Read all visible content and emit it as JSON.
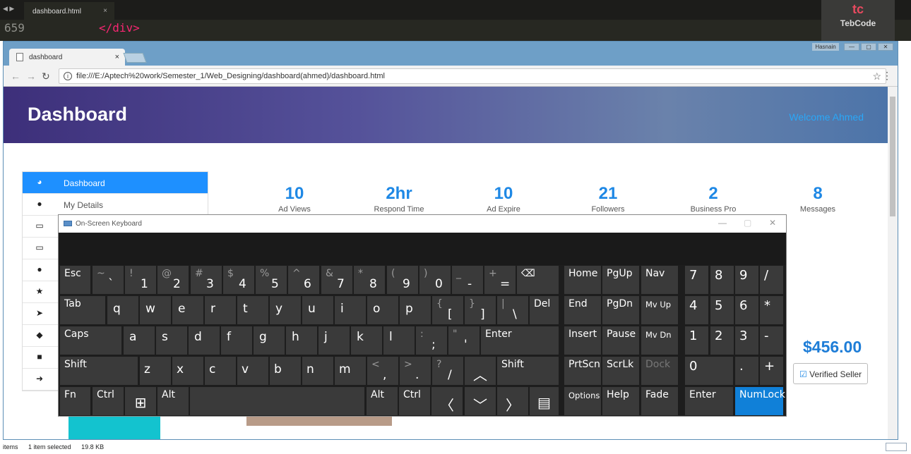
{
  "editor": {
    "tab_label": "dashboard.html",
    "tab_close": "×",
    "nav_arrows": "◀ ▶",
    "menu_glyph": "▼",
    "line_number": "659",
    "code_line": "</div>"
  },
  "logo": {
    "mark": "tc",
    "name": "TebCode"
  },
  "browser": {
    "tab_title": "dashboard",
    "tab_close": "×",
    "user_badge": "Hasnain",
    "window_buttons": [
      "—",
      "▢",
      "✕"
    ],
    "url": "file:///E:/Aptech%20work/Semester_1/Web_Designing/dashboard(ahmed)/dashboard.html",
    "nav": {
      "back": "←",
      "forward": "→",
      "reload": "↻",
      "info": "i",
      "star": "☆",
      "menu": "⋮"
    }
  },
  "page": {
    "title": "Dashboard",
    "welcome": "Welcome Ahmed",
    "sidebar": [
      {
        "label": "Dashboard",
        "icon": "dashboard-icon",
        "glyph": "◕",
        "active": true
      },
      {
        "label": "My Details",
        "icon": "user-icon",
        "glyph": "●",
        "active": false
      },
      {
        "label": "",
        "icon": "laptop-icon",
        "glyph": "▭",
        "active": false
      },
      {
        "label": "",
        "icon": "laptop-icon",
        "glyph": "▭",
        "active": false
      },
      {
        "label": "",
        "icon": "comment-icon",
        "glyph": "●",
        "active": false
      },
      {
        "label": "",
        "icon": "star-icon",
        "glyph": "★",
        "active": false
      },
      {
        "label": "",
        "icon": "paper-plane-icon",
        "glyph": "➤",
        "active": false
      },
      {
        "label": "",
        "icon": "tag-icon",
        "glyph": "◆",
        "active": false
      },
      {
        "label": "",
        "icon": "lock-icon",
        "glyph": "■",
        "active": false
      },
      {
        "label": "",
        "icon": "sign-out-icon",
        "glyph": "➜",
        "active": false
      }
    ],
    "stats": [
      {
        "value": "10",
        "label": "Ad Views"
      },
      {
        "value": "2hr",
        "label": "Respond Time"
      },
      {
        "value": "10",
        "label": "Ad Expire"
      },
      {
        "value": "21",
        "label": "Followers"
      },
      {
        "value": "2",
        "label": "Business Pro"
      },
      {
        "value": "8",
        "label": "Messages"
      }
    ],
    "price": "$456.00",
    "verified_check": "☑",
    "verified": "Verified Seller"
  },
  "osk": {
    "title": "On-Screen Keyboard",
    "controls": [
      "—",
      "▢",
      "✕"
    ],
    "keys": {
      "esc": "Esc",
      "tab": "Tab",
      "caps": "Caps",
      "shift": "Shift",
      "fn": "Fn",
      "ctrl": "Ctrl",
      "alt": "Alt",
      "enter": "Enter",
      "del": "Del",
      "home": "Home",
      "pgup": "PgUp",
      "nav": "Nav",
      "end": "End",
      "pgdn": "PgDn",
      "mvup": "Mv Up",
      "insert": "Insert",
      "pause": "Pause",
      "mvdn": "Mv Dn",
      "prtscn": "PrtScn",
      "scrlk": "ScrLk",
      "dock": "Dock",
      "options": "Options",
      "help": "Help",
      "fade": "Fade",
      "numlock": "NumLock",
      "backspace_glyph": "⌫",
      "win_glyph": "⊞",
      "menu_glyph": "▤",
      "up": "︿",
      "down": "﹀",
      "left": "〈",
      "right": "〉",
      "n0": "0",
      "n1": "1",
      "n2": "2",
      "n3": "3",
      "n4": "4",
      "n5": "5",
      "n6": "6",
      "n7": "7",
      "n8": "8",
      "n9": "9",
      "nslash": "/",
      "nstar": "*",
      "nminus": "-",
      "nplus": "+",
      "ndot": "."
    },
    "row1": [
      {
        "t": "~",
        "b": "`"
      },
      {
        "t": "!",
        "b": "1"
      },
      {
        "t": "@",
        "b": "2"
      },
      {
        "t": "#",
        "b": "3"
      },
      {
        "t": "$",
        "b": "4"
      },
      {
        "t": "%",
        "b": "5"
      },
      {
        "t": "^",
        "b": "6"
      },
      {
        "t": "&",
        "b": "7"
      },
      {
        "t": "*",
        "b": "8"
      },
      {
        "t": "(",
        "b": "9"
      },
      {
        "t": ")",
        "b": "0"
      },
      {
        "t": "_",
        "b": "-"
      },
      {
        "t": "+",
        "b": "="
      }
    ],
    "row2": [
      "q",
      "w",
      "e",
      "r",
      "t",
      "y",
      "u",
      "i",
      "o",
      "p"
    ],
    "row2sym": [
      {
        "t": "{",
        "b": "["
      },
      {
        "t": "}",
        "b": "]"
      },
      {
        "t": "|",
        "b": "\\"
      }
    ],
    "row3": [
      "a",
      "s",
      "d",
      "f",
      "g",
      "h",
      "j",
      "k",
      "l"
    ],
    "row3sym": [
      {
        "t": ":",
        "b": ";"
      },
      {
        "t": "\"",
        "b": "'"
      }
    ],
    "row4": [
      "z",
      "x",
      "c",
      "v",
      "b",
      "n",
      "m"
    ],
    "row4sym": [
      {
        "t": "<",
        "b": ","
      },
      {
        "t": ">",
        "b": "."
      },
      {
        "t": "?",
        "b": "/"
      }
    ]
  },
  "status": {
    "items": "items",
    "selected": "1 item selected",
    "size": "19.8 KB"
  }
}
